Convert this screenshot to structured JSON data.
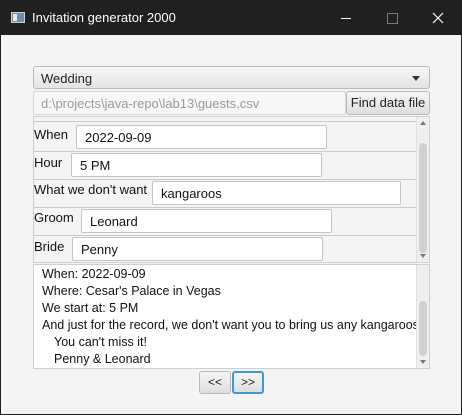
{
  "window": {
    "title": "Invitation generator 2000"
  },
  "event_type": {
    "selected": "Wedding"
  },
  "data_file": {
    "path": "d:\\projects\\java-repo\\lab13\\guests.csv",
    "button_label": "Find data file"
  },
  "form": {
    "fields": [
      {
        "label": "When",
        "value": "2022-09-09"
      },
      {
        "label": "Hour",
        "value": "5 PM"
      },
      {
        "label": "What we don't want",
        "value": "kangaroos"
      },
      {
        "label": "Groom",
        "value": "Leonard"
      },
      {
        "label": "Bride",
        "value": "Penny"
      }
    ]
  },
  "preview": {
    "lines": [
      "When: 2022-09-09",
      "Where: Cesar's Palace in Vegas",
      "We start at: 5 PM",
      "And just for the record, we don't want you to bring us any kangaroos.",
      "You can't miss it!",
      "Penny & Leonard"
    ]
  },
  "nav": {
    "prev_label": "<<",
    "next_label": ">>"
  }
}
